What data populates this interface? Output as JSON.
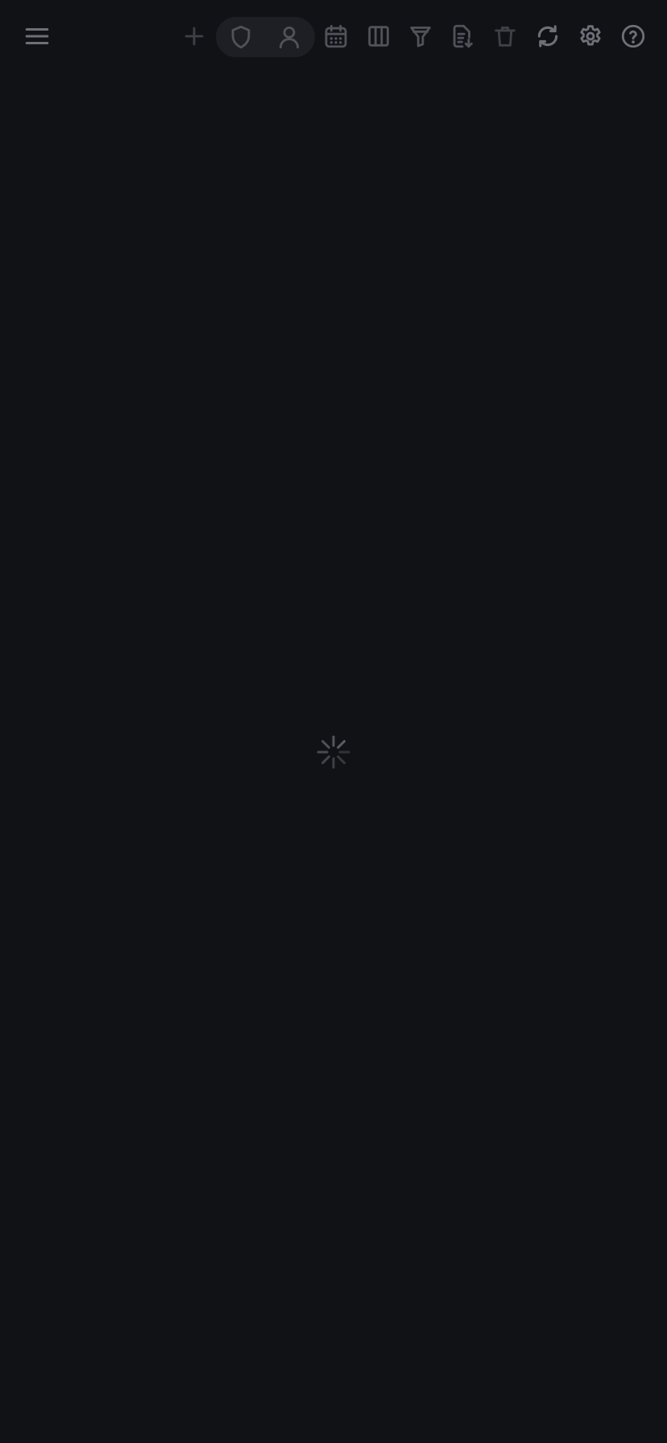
{
  "colors": {
    "background": "#111216",
    "pill_background": "#1e1f24",
    "icon_disabled": "#3f4046",
    "icon_dim": "#50525a",
    "icon_enabled": "#6e7079",
    "spinner": "#5a5c63"
  },
  "toolbar": {
    "menu_icon": "hamburger-menu-icon",
    "add_icon": "plus-icon",
    "view_toggle": {
      "options": [
        "shield-icon",
        "user-icon"
      ]
    },
    "calendar_icon": "calendar-icon",
    "columns_icon": "columns-icon",
    "filter_icon": "filter-icon",
    "export_icon": "document-download-icon",
    "delete_icon": "trash-icon",
    "refresh_icon": "refresh-icon",
    "settings_icon": "gear-icon",
    "help_icon": "question-circle-icon"
  },
  "main": {
    "state": "loading",
    "spinner_icon": "loading-spinner-icon"
  }
}
